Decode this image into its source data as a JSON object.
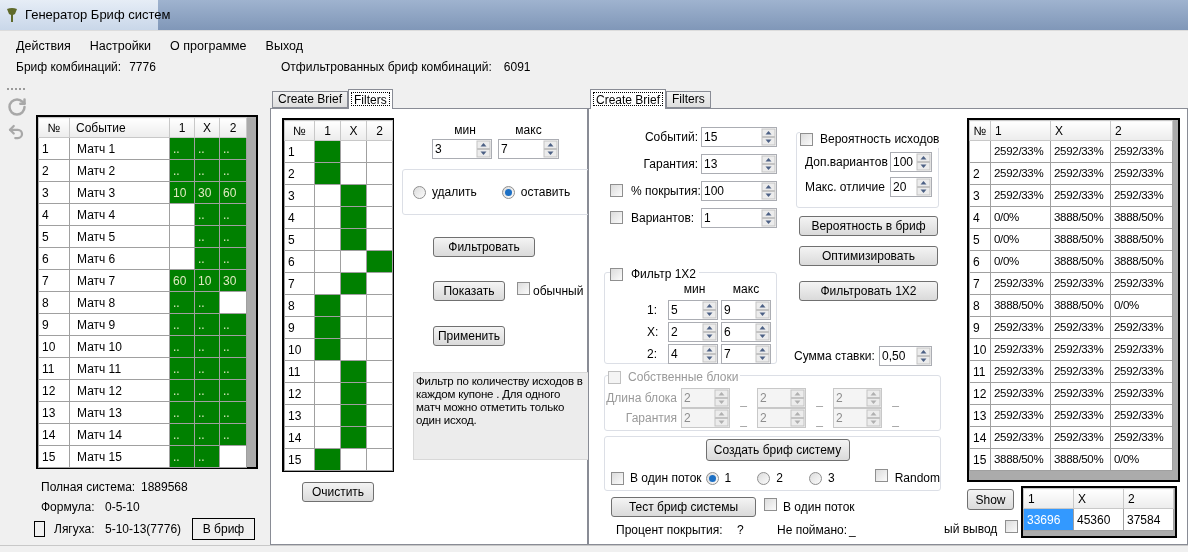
{
  "window": {
    "title": "Генератор Бриф систем"
  },
  "menu": [
    {
      "label": "Действия"
    },
    {
      "label": "Настройки"
    },
    {
      "label": "О программе"
    },
    {
      "label": "Выход"
    }
  ],
  "stats": {
    "brief_label": "Бриф комбинаций:",
    "brief_value": "7776",
    "filtered_label": "Отфильтрованных бриф комбинаций:",
    "filtered_value": "6091"
  },
  "events_table": {
    "columns": [
      "№",
      "Событие",
      "1",
      "X",
      "2"
    ],
    "rows": [
      {
        "cells": [
          {
            "text": "1",
            "selected": false
          },
          {
            "text": "Матч 1",
            "selected": false
          },
          {
            "text": "..",
            "selected": true
          },
          {
            "text": "..",
            "selected": true
          },
          {
            "text": "..",
            "selected": true
          }
        ]
      },
      {
        "cells": [
          {
            "text": "2",
            "selected": false
          },
          {
            "text": "Матч 2",
            "selected": false
          },
          {
            "text": "..",
            "selected": true
          },
          {
            "text": "..",
            "selected": true
          },
          {
            "text": "..",
            "selected": true
          }
        ]
      },
      {
        "cells": [
          {
            "text": "3",
            "selected": false
          },
          {
            "text": "Матч 3",
            "selected": false
          },
          {
            "text": "10",
            "selected": true
          },
          {
            "text": "30",
            "selected": true
          },
          {
            "text": "60",
            "selected": true
          }
        ]
      },
      {
        "cells": [
          {
            "text": "4",
            "selected": false
          },
          {
            "text": "Матч 4",
            "selected": false
          },
          {
            "selected": false
          },
          {
            "text": "..",
            "selected": true
          },
          {
            "text": "..",
            "selected": true
          }
        ]
      },
      {
        "cells": [
          {
            "text": "5",
            "selected": false
          },
          {
            "text": "Матч 5",
            "selected": false
          },
          {
            "selected": false
          },
          {
            "text": "..",
            "selected": true
          },
          {
            "text": "..",
            "selected": true
          }
        ]
      },
      {
        "cells": [
          {
            "text": "6",
            "selected": false
          },
          {
            "text": "Матч 6",
            "selected": false
          },
          {
            "selected": false
          },
          {
            "text": "..",
            "selected": true
          },
          {
            "text": "..",
            "selected": true
          }
        ]
      },
      {
        "cells": [
          {
            "text": "7",
            "selected": false
          },
          {
            "text": "Матч 7",
            "selected": false
          },
          {
            "text": "60",
            "selected": true
          },
          {
            "text": "10",
            "selected": true
          },
          {
            "text": "30",
            "selected": true
          }
        ]
      },
      {
        "cells": [
          {
            "text": "8",
            "selected": false
          },
          {
            "text": "Матч 8",
            "selected": false
          },
          {
            "text": "..",
            "selected": true
          },
          {
            "text": "..",
            "selected": true
          },
          {
            "selected": false
          }
        ]
      },
      {
        "cells": [
          {
            "text": "9",
            "selected": false
          },
          {
            "text": "Матч 9",
            "selected": false
          },
          {
            "text": "..",
            "selected": true
          },
          {
            "text": "..",
            "selected": true
          },
          {
            "text": "..",
            "selected": true
          }
        ]
      },
      {
        "cells": [
          {
            "text": "10",
            "selected": false
          },
          {
            "text": "Матч 10",
            "selected": false
          },
          {
            "text": "..",
            "selected": true
          },
          {
            "text": "..",
            "selected": true
          },
          {
            "text": "..",
            "selected": true
          }
        ]
      },
      {
        "cells": [
          {
            "text": "11",
            "selected": false
          },
          {
            "text": "Матч 11",
            "selected": false
          },
          {
            "text": "..",
            "selected": true
          },
          {
            "text": "..",
            "selected": true
          },
          {
            "text": "..",
            "selected": true
          }
        ]
      },
      {
        "cells": [
          {
            "text": "12",
            "selected": false
          },
          {
            "text": "Матч 12",
            "selected": false
          },
          {
            "text": "..",
            "selected": true
          },
          {
            "text": "..",
            "selected": true
          },
          {
            "text": "..",
            "selected": true
          }
        ]
      },
      {
        "cells": [
          {
            "text": "13",
            "selected": false
          },
          {
            "text": "Матч 13",
            "selected": false
          },
          {
            "text": "..",
            "selected": true
          },
          {
            "text": "..",
            "selected": true
          },
          {
            "text": "..",
            "selected": true
          }
        ]
      },
      {
        "cells": [
          {
            "text": "14",
            "selected": false
          },
          {
            "text": "Матч 14",
            "selected": false
          },
          {
            "text": "..",
            "selected": true
          },
          {
            "text": "..",
            "selected": true
          },
          {
            "text": "..",
            "selected": true
          }
        ]
      },
      {
        "cells": [
          {
            "text": "15",
            "selected": false
          },
          {
            "text": "Матч 15",
            "selected": false
          },
          {
            "text": "..",
            "selected": true
          },
          {
            "text": "..",
            "selected": true
          },
          {
            "selected": false
          }
        ]
      }
    ]
  },
  "summary": {
    "full_label": "Полная система:",
    "full_value": "1889568",
    "formula_label": "Формула:",
    "formula_value": "0-5-10",
    "frog_checked": false,
    "frog_label": "Лягуха:",
    "frog_value": "5-10-13(7776)",
    "button": "В бриф"
  },
  "filters_tab": {
    "tabs": [
      {
        "label": "Create Brief",
        "selected": false
      },
      {
        "label": "Filters",
        "selected": true
      }
    ],
    "table": {
      "columns": [
        "№",
        "1",
        "X",
        "2"
      ],
      "rows": [
        {
          "num": "1",
          "cells": [
            {
              "selected": true
            },
            {
              "selected": false
            },
            {
              "selected": false
            }
          ]
        },
        {
          "num": "2",
          "cells": [
            {
              "selected": true
            },
            {
              "selected": false
            },
            {
              "selected": false
            }
          ]
        },
        {
          "num": "3",
          "cells": [
            {
              "selected": false
            },
            {
              "selected": true
            },
            {
              "selected": false
            }
          ]
        },
        {
          "num": "4",
          "cells": [
            {
              "selected": false
            },
            {
              "selected": true
            },
            {
              "selected": false
            }
          ]
        },
        {
          "num": "5",
          "cells": [
            {
              "selected": false
            },
            {
              "selected": true
            },
            {
              "selected": false
            }
          ]
        },
        {
          "num": "6",
          "cells": [
            {
              "selected": false
            },
            {
              "selected": false
            },
            {
              "selected": true
            }
          ]
        },
        {
          "num": "7",
          "cells": [
            {
              "selected": false
            },
            {
              "selected": true
            },
            {
              "selected": false
            }
          ]
        },
        {
          "num": "8",
          "cells": [
            {
              "selected": true
            },
            {
              "selected": false
            },
            {
              "selected": false
            }
          ]
        },
        {
          "num": "9",
          "cells": [
            {
              "selected": true
            },
            {
              "selected": false
            },
            {
              "selected": false
            }
          ]
        },
        {
          "num": "10",
          "cells": [
            {
              "selected": true
            },
            {
              "selected": false
            },
            {
              "selected": false
            }
          ]
        },
        {
          "num": "11",
          "cells": [
            {
              "selected": false
            },
            {
              "selected": true
            },
            {
              "selected": false
            }
          ]
        },
        {
          "num": "12",
          "cells": [
            {
              "selected": false
            },
            {
              "selected": true
            },
            {
              "selected": false
            }
          ]
        },
        {
          "num": "13",
          "cells": [
            {
              "selected": false
            },
            {
              "selected": true
            },
            {
              "selected": false
            }
          ]
        },
        {
          "num": "14",
          "cells": [
            {
              "selected": false
            },
            {
              "selected": true
            },
            {
              "selected": false
            }
          ]
        },
        {
          "num": "15",
          "cells": [
            {
              "selected": true
            },
            {
              "selected": false
            },
            {
              "selected": false
            }
          ]
        }
      ]
    },
    "clear_button": "Очистить",
    "min_label": "мин",
    "max_label": "макс",
    "min_value": "3",
    "max_value": "7",
    "radios": [
      {
        "label": "удалить",
        "selected": false
      },
      {
        "label": "оставить",
        "selected": true
      }
    ],
    "filter_button": "Фильтровать",
    "show_button": "Показать",
    "plain_checkbox": {
      "label": "обычный",
      "checked": false
    },
    "apply_button": "Применить",
    "description": "Фильтр по количеству исходов в каждом купоне . Для одного матч можно отметить только один исход."
  },
  "create_tab": {
    "tabs": [
      {
        "label": "Create Brief",
        "selected": true
      },
      {
        "label": "Filters",
        "selected": false
      }
    ],
    "fields": [
      {
        "kind": "plain",
        "label": "Событий:",
        "value": "15"
      },
      {
        "kind": "plain",
        "label": "Гарантия:",
        "value": "13"
      },
      {
        "kind": "checkbox",
        "label": "% покрытия:",
        "value": "100",
        "checked": false
      },
      {
        "kind": "checkbox",
        "label": "Вариантов:",
        "value": "1",
        "checked": false
      }
    ],
    "probability": {
      "label": "Вероятность исходов",
      "checked": false,
      "fields": [
        {
          "label": "Доп.вариантов",
          "value": "100"
        },
        {
          "label": "Макс. отличие",
          "value": "20"
        }
      ]
    },
    "action_buttons": [
      "Вероятность в бриф",
      "Оптимизировать",
      "Фильтровать 1X2"
    ],
    "filter_1x2": {
      "label": "Фильтр 1X2",
      "checked": false,
      "min_label": "мин",
      "max_label": "макс",
      "rows": [
        {
          "label": "1:",
          "min": "5",
          "max": "9"
        },
        {
          "label": "X:",
          "min": "2",
          "max": "6"
        },
        {
          "label": "2:",
          "min": "4",
          "max": "7"
        }
      ]
    },
    "stake": {
      "label": "Сумма ставки:",
      "value": "0,50"
    },
    "own_blocks": {
      "label": "Собственные блоки",
      "checked": false,
      "disabled": true,
      "rows": [
        {
          "label": "Длина блока",
          "values": [
            "2",
            "2",
            "2"
          ],
          "separators": [
            "_",
            "_",
            "_"
          ]
        },
        {
          "label": "Гарантия",
          "values": [
            "2",
            "2",
            "2"
          ],
          "separators": [
            "_",
            "_",
            "_"
          ]
        }
      ]
    },
    "create": {
      "button": "Создать бриф систему",
      "single_thread": {
        "label": "В один поток",
        "checked": false
      },
      "threads": [
        {
          "label": "1",
          "selected": true
        },
        {
          "label": "2",
          "selected": false
        },
        {
          "label": "3",
          "selected": false
        }
      ],
      "random": {
        "label": "Random",
        "checked": false
      }
    },
    "test": {
      "button": "Тест бриф системы",
      "single_thread": {
        "label": "В один поток",
        "checked": false
      },
      "coverage_label": "Процент покрытия:",
      "coverage_value": "?",
      "missed_label": "Не поймано:",
      "missed_value": "_"
    }
  },
  "prob_table": {
    "columns": [
      "№",
      "1",
      "X",
      "2"
    ],
    "rows": [
      {
        "values": [
          "2592/33%",
          "2592/33%",
          "2592/33%"
        ]
      },
      {
        "num": "2",
        "values": [
          "2592/33%",
          "2592/33%",
          "2592/33%"
        ]
      },
      {
        "num": "3",
        "values": [
          "2592/33%",
          "2592/33%",
          "2592/33%"
        ]
      },
      {
        "num": "4",
        "values": [
          "0/0%",
          "3888/50%",
          "3888/50%"
        ]
      },
      {
        "num": "5",
        "values": [
          "0/0%",
          "3888/50%",
          "3888/50%"
        ]
      },
      {
        "num": "6",
        "values": [
          "0/0%",
          "3888/50%",
          "3888/50%"
        ]
      },
      {
        "num": "7",
        "values": [
          "2592/33%",
          "2592/33%",
          "2592/33%"
        ]
      },
      {
        "num": "8",
        "values": [
          "3888/50%",
          "3888/50%",
          "0/0%"
        ]
      },
      {
        "num": "9",
        "values": [
          "2592/33%",
          "2592/33%",
          "2592/33%"
        ]
      },
      {
        "num": "10",
        "values": [
          "2592/33%",
          "2592/33%",
          "2592/33%"
        ]
      },
      {
        "num": "11",
        "values": [
          "2592/33%",
          "2592/33%",
          "2592/33%"
        ]
      },
      {
        "num": "12",
        "values": [
          "2592/33%",
          "2592/33%",
          "2592/33%"
        ]
      },
      {
        "num": "13",
        "values": [
          "2592/33%",
          "2592/33%",
          "2592/33%"
        ]
      },
      {
        "num": "14",
        "values": [
          "2592/33%",
          "2592/33%",
          "2592/33%"
        ]
      },
      {
        "num": "15",
        "values": [
          "3888/50%",
          "3888/50%",
          "0/0%"
        ]
      }
    ]
  },
  "show_button": "Show",
  "output_checkbox": {
    "label": "ый вывод",
    "checked": false
  },
  "totals": {
    "columns": [
      "1",
      "X",
      "2"
    ],
    "cells": [
      {
        "text": "33696",
        "selected": true
      },
      {
        "text": "45360",
        "selected": false
      },
      {
        "text": "37584",
        "selected": false
      }
    ]
  }
}
